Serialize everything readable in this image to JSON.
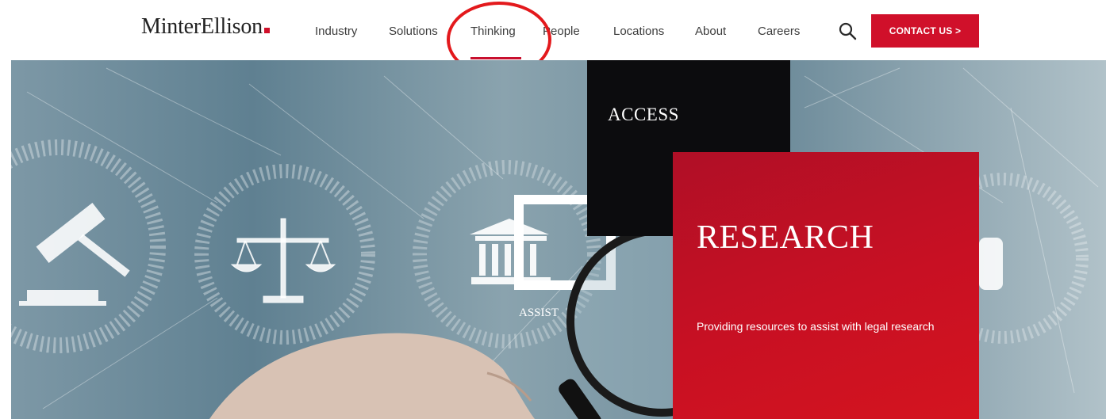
{
  "brand": {
    "name": "MinterEllison",
    "accent_color": "#d0102a"
  },
  "nav": {
    "items": [
      {
        "label": "Industry"
      },
      {
        "label": "Solutions"
      },
      {
        "label": "Thinking",
        "active": true
      },
      {
        "label": "People"
      },
      {
        "label": "Locations"
      },
      {
        "label": "About"
      },
      {
        "label": "Careers"
      }
    ],
    "search_icon": "search-icon",
    "contact_label": "CONTACT US >"
  },
  "annotation": {
    "type": "circle",
    "color": "#e3191c",
    "target": "Thinking"
  },
  "hero": {
    "access_label": "ACCESS",
    "assist_label": "ASSIST",
    "research_title": "RESEARCH",
    "research_description": "Providing resources to assist with legal research",
    "icons": [
      "gavel-icon",
      "scales-icon",
      "courthouse-icon",
      "magnifying-glass-icon"
    ]
  }
}
